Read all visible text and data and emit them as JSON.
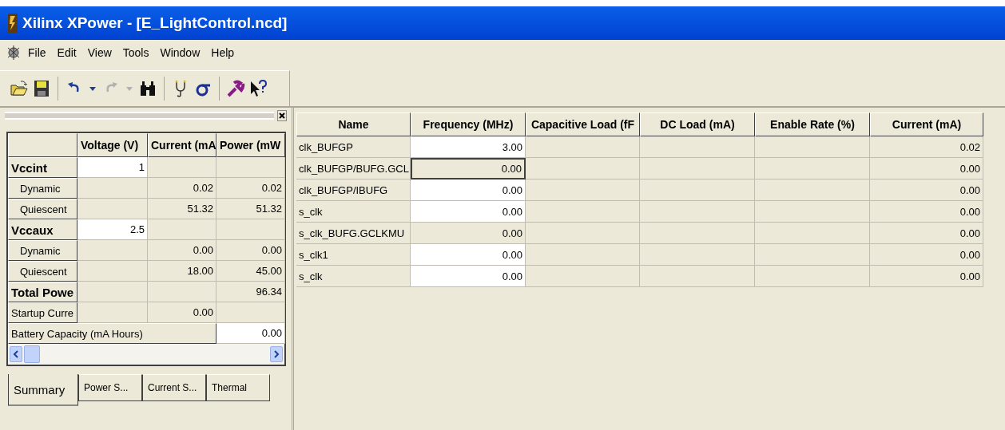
{
  "window": {
    "title": "Xilinx XPower - [E_LightControl.ncd]"
  },
  "menu": [
    "File",
    "Edit",
    "View",
    "Tools",
    "Window",
    "Help"
  ],
  "toolbar": [
    {
      "kind": "open"
    },
    {
      "kind": "save"
    },
    {
      "kind": "sep"
    },
    {
      "kind": "undo"
    },
    {
      "kind": "dropdown",
      "disabled": false
    },
    {
      "kind": "redo"
    },
    {
      "kind": "dropdown",
      "disabled": true
    },
    {
      "kind": "find"
    },
    {
      "kind": "sep"
    },
    {
      "kind": "probe"
    },
    {
      "kind": "sigma"
    },
    {
      "kind": "sep"
    },
    {
      "kind": "tool"
    },
    {
      "kind": "help"
    }
  ],
  "summary": {
    "columns": [
      "",
      "Voltage (V)",
      "Current (mA",
      "Power (mW"
    ],
    "rows": [
      {
        "kind": "group",
        "label": "Vccint",
        "voltage": "1",
        "current": "",
        "power": ""
      },
      {
        "kind": "sub",
        "label": "Dynamic",
        "voltage": "",
        "current": "0.02",
        "power": "0.02"
      },
      {
        "kind": "sub",
        "label": "Quiescent",
        "voltage": "",
        "current": "51.32",
        "power": "51.32"
      },
      {
        "kind": "group",
        "label": "Vccaux",
        "voltage": "2.5",
        "current": "",
        "power": ""
      },
      {
        "kind": "sub",
        "label": "Dynamic",
        "voltage": "",
        "current": "0.00",
        "power": "0.00"
      },
      {
        "kind": "sub",
        "label": "Quiescent",
        "voltage": "",
        "current": "18.00",
        "power": "45.00"
      },
      {
        "kind": "total",
        "label": "Total Powe",
        "voltage": "",
        "current": "",
        "power": "96.34"
      },
      {
        "kind": "plain",
        "label": "Startup Curre",
        "voltage": "",
        "current": "0.00",
        "power": ""
      },
      {
        "kind": "wide",
        "label": "Battery Capacity (mA Hours)",
        "power": "0.00"
      }
    ]
  },
  "tabs": [
    {
      "label": "Summary",
      "selected": true
    },
    {
      "label": "Power S...",
      "selected": false
    },
    {
      "label": "Current S...",
      "selected": false
    },
    {
      "label": "Thermal",
      "selected": false
    }
  ],
  "table": {
    "columns": [
      "Name",
      "Frequency (MHz)",
      "Capacitive Load (fF",
      "DC Load (mA)",
      "Enable Rate (%)",
      "Current (mA)"
    ],
    "rows": [
      {
        "name": "clk_BUFGP",
        "frequency": "3.00",
        "editable": true,
        "focused": false,
        "current": "0.02"
      },
      {
        "name": "clk_BUFGP/BUFG.GCL",
        "frequency": "0.00",
        "editable": false,
        "focused": true,
        "current": "0.00"
      },
      {
        "name": "clk_BUFGP/IBUFG",
        "frequency": "0.00",
        "editable": true,
        "focused": false,
        "current": "0.00"
      },
      {
        "name": "s_clk",
        "frequency": "0.00",
        "editable": true,
        "focused": false,
        "current": "0.00"
      },
      {
        "name": "s_clk_BUFG.GCLKMU",
        "frequency": "0.00",
        "editable": false,
        "focused": false,
        "current": "0.00"
      },
      {
        "name": "s_clk1",
        "frequency": "0.00",
        "editable": true,
        "focused": false,
        "current": "0.00"
      },
      {
        "name": "s_clk",
        "frequency": "0.00",
        "editable": true,
        "focused": false,
        "current": "0.00"
      }
    ]
  }
}
